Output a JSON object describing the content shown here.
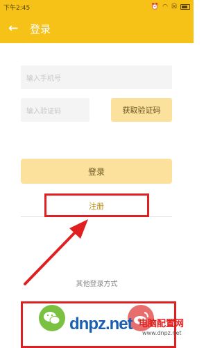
{
  "status_bar": {
    "time": "下午2:45",
    "icons": [
      "alarm-icon",
      "wifi-icon",
      "sim-icon",
      "battery-icon"
    ]
  },
  "app_bar": {
    "back_icon": "←",
    "title": "登录"
  },
  "form": {
    "phone_placeholder": "输入手机号",
    "code_placeholder": "输入验证码",
    "get_code_label": "获取验证码",
    "login_label": "登录",
    "register_label": "注册"
  },
  "other_login": {
    "label": "其他登录方式",
    "options": [
      "wechat-icon",
      "weibo-icon"
    ]
  },
  "watermark": {
    "logo": "dnpz.net",
    "name": "电脑配置网",
    "domain": "www.dnpz.net"
  },
  "colors": {
    "accent": "#f7c218",
    "button": "#fbe19c",
    "highlight": "#e02020"
  }
}
